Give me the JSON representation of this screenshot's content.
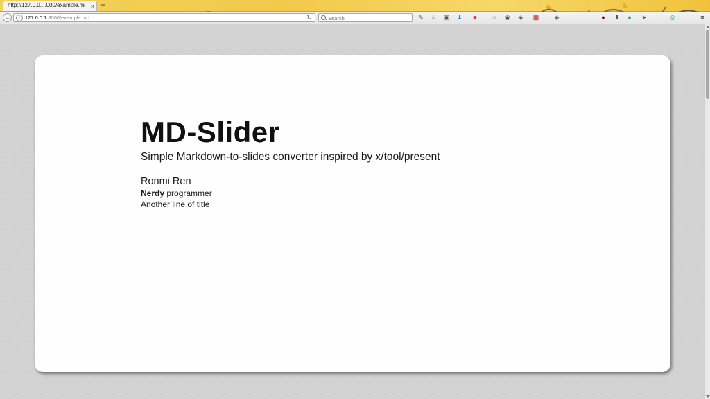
{
  "browser": {
    "tab_title": "http://127.0.0....000/example.md",
    "tab_close": "×",
    "new_tab": "+",
    "url_host": "127.0.0.1",
    "url_rest": ":8000/example.md",
    "search_placeholder": "Search",
    "back_glyph": "←",
    "reload_glyph": "↻"
  },
  "toolbar_icons": [
    {
      "name": "wrench-icon",
      "glyph": "✎",
      "color": "#555555"
    },
    {
      "name": "bookmark-star-icon",
      "glyph": "☆",
      "color": "#555555"
    },
    {
      "name": "reading-list-icon",
      "glyph": "▣",
      "color": "#555555"
    },
    {
      "name": "download-icon",
      "glyph": "⬇",
      "color": "#1e7be0"
    },
    {
      "name": "extension-badge-icon",
      "glyph": "■",
      "color": "#d23a3a"
    },
    {
      "name": "home-icon",
      "glyph": "⌂",
      "color": "#555555"
    },
    {
      "name": "sync-icon",
      "glyph": "◉",
      "color": "#555555"
    },
    {
      "name": "pocket-icon",
      "glyph": "◈",
      "color": "#555555"
    },
    {
      "name": "addon-red-icon",
      "glyph": "▦",
      "color": "#b3261e"
    },
    {
      "name": "addon-shield-icon",
      "glyph": "◆",
      "color": "#7a7a7a"
    },
    {
      "name": "ublock-icon",
      "glyph": "●",
      "color": "#800000"
    },
    {
      "name": "addon-download-icon",
      "glyph": "⬇",
      "color": "#555555"
    },
    {
      "name": "addon-green-icon",
      "glyph": "●",
      "color": "#3aa835"
    },
    {
      "name": "send-icon",
      "glyph": "➤",
      "color": "#555555"
    },
    {
      "name": "addon-chrome-icon",
      "glyph": "◎",
      "color": "#2e9d5a"
    },
    {
      "name": "menu-icon",
      "glyph": "≡",
      "color": "#333333"
    }
  ],
  "slide": {
    "title": "MD-Slider",
    "subtitle": "Simple Markdown-to-slides converter inspired by x/tool/present",
    "author": "Ronmi Ren",
    "line1_bold": "Nerdy",
    "line1_rest": " programmer",
    "line2": "Another line of title"
  },
  "colors": {
    "tabbar_accent": "#f3c94a",
    "page_bg": "#d6d6d6",
    "slide_bg": "#fefefe",
    "text": "#111111"
  }
}
